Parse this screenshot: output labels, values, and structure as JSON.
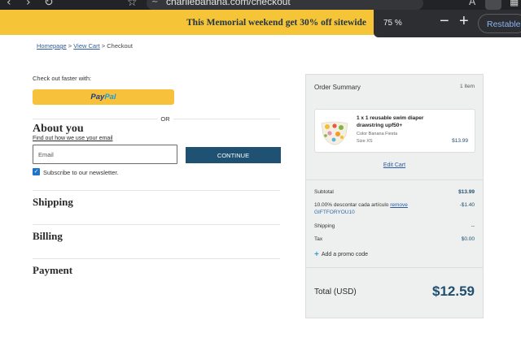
{
  "browser": {
    "url": "charliebanana.com/checkout"
  },
  "banner": {
    "text": "This Memorial weekend get 30% off sitewide"
  },
  "zoom_popup": {
    "level": "75 %",
    "minus": "−",
    "plus": "+",
    "reset_label": "Restablec"
  },
  "breadcrumb": {
    "home": "Homepage",
    "sep1": ">",
    "cart": "View Cart",
    "sep2": ">",
    "current": "Checkout"
  },
  "checkout": {
    "faster_label": "Check out faster with:",
    "paypal": {
      "part1": "Pay",
      "part2": "Pal"
    },
    "or_label": "OR",
    "about_title": "About you",
    "about_link": "Find out how we use your email",
    "email_placeholder": "Email",
    "email_value": "",
    "continue_label": "CONTINUE",
    "subscribe_checked": true,
    "subscribe_label": "Subscribe to our newsletter.",
    "sections": [
      "Shipping",
      "Billing",
      "Payment"
    ]
  },
  "summary": {
    "title": "Order Summary",
    "item_count": "1 Item",
    "item": {
      "name": "1 x 1 reusable swim diaper drawstring upf50+",
      "color": "Color Banana Fiesta",
      "size": "Size XS",
      "price": "$13.99"
    },
    "edit_cart": "Edit Cart",
    "subtotal_label": "Subtotal",
    "subtotal_value": "$13.99",
    "discount_label": "10.00% descontar cada artículo",
    "discount_remove": "remove",
    "discount_code": "GIFTFORYOU10",
    "discount_value": "-$1.40",
    "shipping_label": "Shipping",
    "shipping_value": "--",
    "tax_label": "Tax",
    "tax_value": "$0.00",
    "promo_label": "Add a promo code",
    "total_label": "Total (USD)",
    "total_value": "$12.59"
  },
  "colors": {
    "banner": "#f6c437",
    "accent": "#1f5272",
    "link": "#2c5aa0",
    "paypal": "#f7c13b"
  }
}
